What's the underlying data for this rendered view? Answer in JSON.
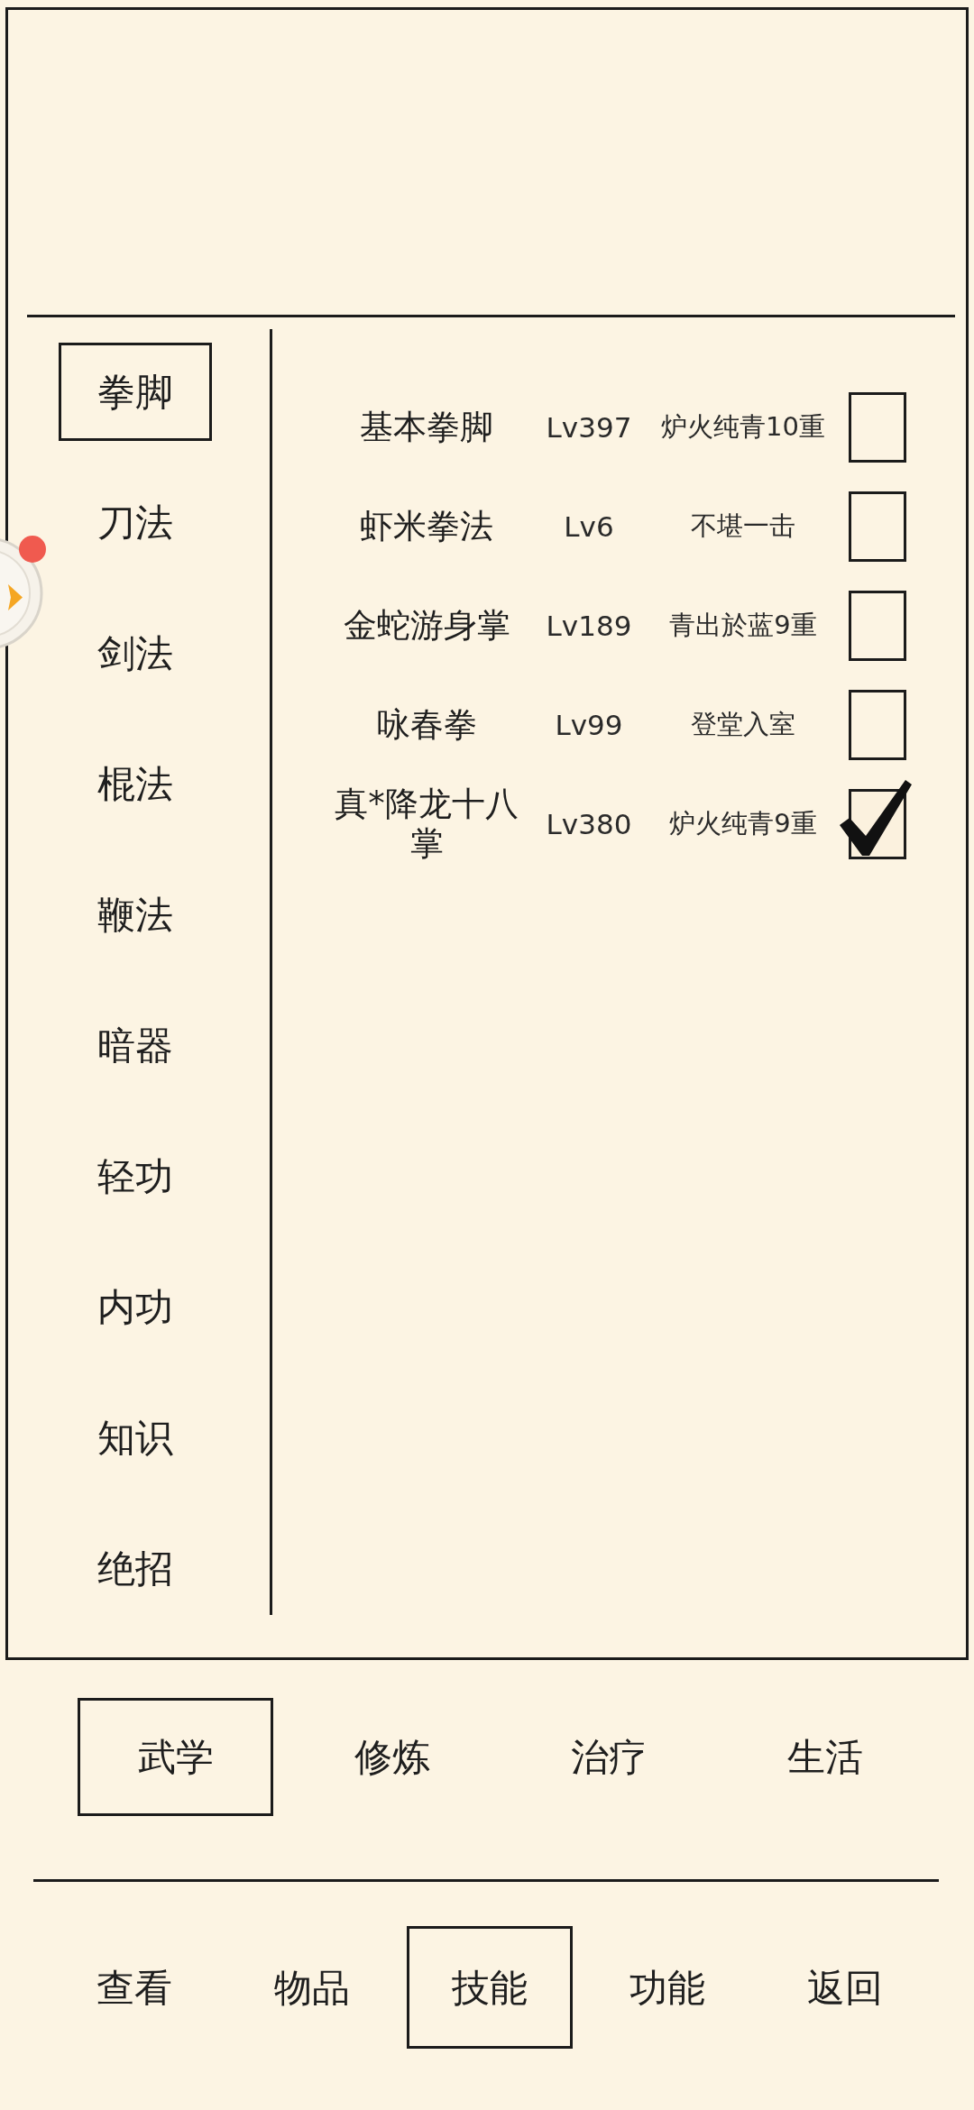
{
  "sidebar": {
    "items": [
      {
        "label": "拳脚",
        "selected": true
      },
      {
        "label": "刀法",
        "selected": false
      },
      {
        "label": "剑法",
        "selected": false
      },
      {
        "label": "棍法",
        "selected": false
      },
      {
        "label": "鞭法",
        "selected": false
      },
      {
        "label": "暗器",
        "selected": false
      },
      {
        "label": "轻功",
        "selected": false
      },
      {
        "label": "内功",
        "selected": false
      },
      {
        "label": "知识",
        "selected": false
      },
      {
        "label": "绝招",
        "selected": false
      }
    ]
  },
  "skills": [
    {
      "name": "基本拳脚",
      "lv": "Lv397",
      "stage": "炉火纯青10重",
      "checked": false
    },
    {
      "name": "虾米拳法",
      "lv": "Lv6",
      "stage": "不堪一击",
      "checked": false
    },
    {
      "name": "金蛇游身掌",
      "lv": "Lv189",
      "stage": "青出於蓝9重",
      "checked": false
    },
    {
      "name": "咏春拳",
      "lv": "Lv99",
      "stage": "登堂入室",
      "checked": false
    },
    {
      "name": "真*降龙十八掌",
      "lv": "Lv380",
      "stage": "炉火纯青9重",
      "checked": true
    }
  ],
  "category_tabs": [
    {
      "label": "武学",
      "selected": true
    },
    {
      "label": "修炼",
      "selected": false
    },
    {
      "label": "治疗",
      "selected": false
    },
    {
      "label": "生活",
      "selected": false
    }
  ],
  "bottom_nav": [
    {
      "label": "查看",
      "selected": false
    },
    {
      "label": "物品",
      "selected": false
    },
    {
      "label": "技能",
      "selected": true
    },
    {
      "label": "功能",
      "selected": false
    },
    {
      "label": "返回",
      "selected": false
    }
  ],
  "floating_button": {
    "notification": true
  }
}
